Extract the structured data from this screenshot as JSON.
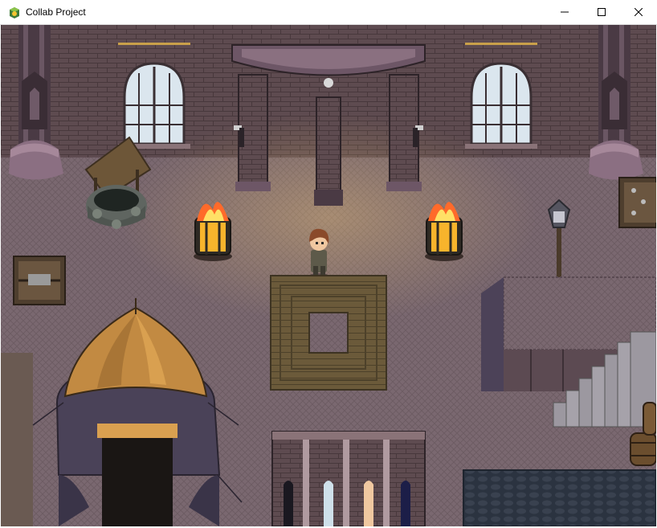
{
  "window": {
    "title": "Collab Project",
    "minimize_icon": "minimize-icon",
    "maximize_icon": "maximize-icon",
    "close_icon": "close-icon",
    "app_icon": "rpg-maker-icon"
  },
  "colors": {
    "brick": "#5e4b50",
    "brick_line": "#48383c",
    "floor": "#7a6870",
    "fire": "#f7b42c",
    "tent_top": "#c28a42",
    "tent_curtain": "#4a4258",
    "water": "#2b3340",
    "rug": "#6b5a3a"
  },
  "scene": {
    "player_character": "player-sprite",
    "objects": [
      "stone-well",
      "brazier-left",
      "brazier-right",
      "street-lamp",
      "tent",
      "wooden-rug",
      "archway-gate",
      "staircase",
      "crate-left",
      "crate-right",
      "barrels"
    ]
  }
}
